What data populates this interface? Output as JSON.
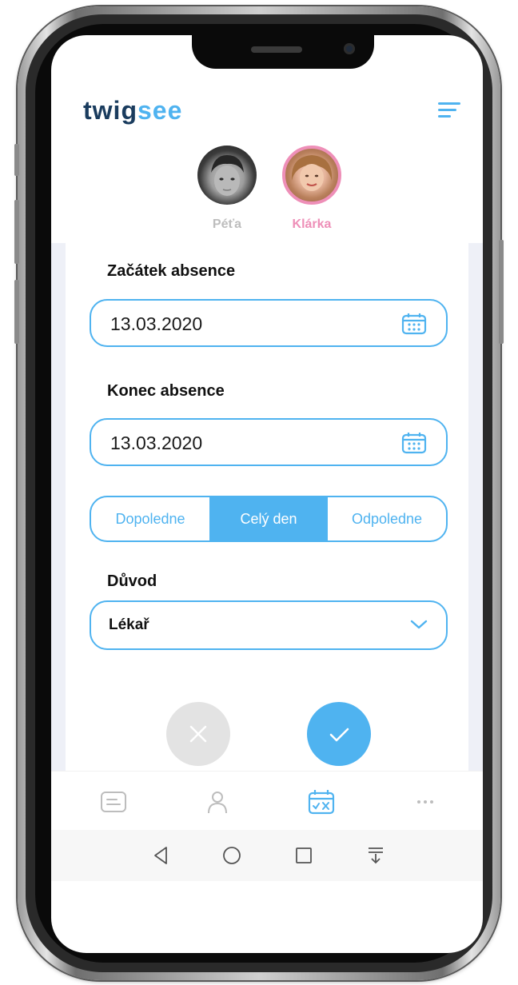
{
  "app": {
    "logo_part1": "twig",
    "logo_part2": "see"
  },
  "children": [
    {
      "name": "Péťa",
      "selected": false
    },
    {
      "name": "Klárka",
      "selected": true
    }
  ],
  "form": {
    "start_label": "Začátek absence",
    "start_value": "13.03.2020",
    "end_label": "Konec absence",
    "end_value": "13.03.2020",
    "segments": [
      {
        "label": "Dopoledne",
        "active": false
      },
      {
        "label": "Celý den",
        "active": true
      },
      {
        "label": "Odpoledne",
        "active": false
      }
    ],
    "reason_label": "Důvod",
    "reason_value": "Lékař"
  },
  "actions": {
    "cancel_icon": "close-icon",
    "confirm_icon": "check-icon"
  },
  "bottom_nav": [
    "messages-icon",
    "profile-icon",
    "absence-calendar-icon",
    "more-icon"
  ],
  "system_nav": [
    "back-icon",
    "home-icon",
    "recents-icon",
    "notifications-icon"
  ],
  "colors": {
    "accent": "#4fb3f0",
    "logo_dark": "#1a3c5e",
    "child_selected": "#ee8fb8",
    "child_unselected": "#bdbdbd",
    "cancel_bg": "#e3e3e3",
    "side_panel": "#eef0f7"
  }
}
